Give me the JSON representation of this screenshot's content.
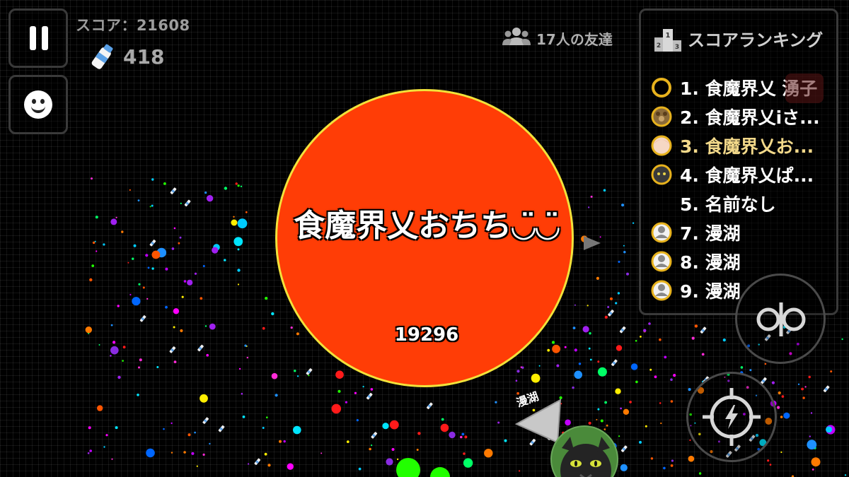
{
  "hud": {
    "score_label": "スコア：21608",
    "milk_count": "418",
    "friends_label": "17人の友達"
  },
  "leaderboard": {
    "title": "スコアランキング",
    "entries": [
      {
        "text": "1. 食魔界乂 湧子",
        "avatar": "ring-icon",
        "me": false
      },
      {
        "text": "2. 食魔界乂iさ...",
        "avatar": "bear-avatar",
        "me": false
      },
      {
        "text": "3. 食魔界乂お...",
        "avatar": "girl-avatar",
        "me": true
      },
      {
        "text": "4. 食魔界乂ぱ...",
        "avatar": "cat-avatar",
        "me": false
      },
      {
        "text": "5. 名前なし",
        "avatar": "",
        "me": false
      },
      {
        "text": "7. 漫湖",
        "avatar": "face-avatar",
        "me": false
      },
      {
        "text": "8. 漫湖",
        "avatar": "face-avatar",
        "me": false
      },
      {
        "text": "9. 漫湖",
        "avatar": "face-avatar",
        "me": false
      }
    ]
  },
  "player": {
    "name": "食魔界乂おちち◡̈◡̈",
    "mass": "19296",
    "color": "#ff3d06",
    "border_color": "#f2e23a"
  },
  "ally": {
    "name": "漫湖"
  },
  "controls": {
    "split_icon": "split-icon",
    "boost_icon": "lightning-target-icon"
  },
  "colors": {
    "background": "#000000",
    "gold_ring": "#e7b21d",
    "me_text": "#f3d98a"
  }
}
